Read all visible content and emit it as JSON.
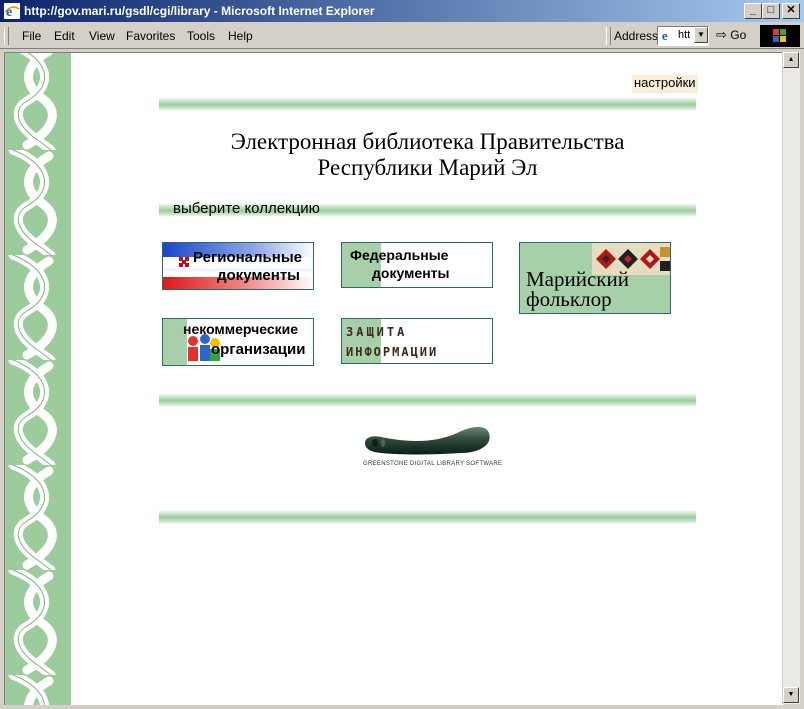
{
  "window": {
    "title": "http://gov.mari.ru/gsdl/cgi/library - Microsoft Internet Explorer",
    "minimize": "_",
    "maximize": "□",
    "close": "✕"
  },
  "menu": {
    "file": "File",
    "edit": "Edit",
    "view": "View",
    "favorites": "Favorites",
    "tools": "Tools",
    "help": "Help"
  },
  "address": {
    "label": "Address",
    "value": "htt",
    "go": "Go"
  },
  "page": {
    "preferences": "настройки",
    "heading_line1": "Электронная библиотека Правительства",
    "heading_line2": "Республики Марий Эл",
    "choose_collection": "выберите коллекцию",
    "collections": [
      {
        "line1": "Региональные",
        "line2": "документы"
      },
      {
        "line1": "Федеральные",
        "line2": "документы"
      },
      {
        "line1": "Марийский",
        "line2": "фольклор"
      },
      {
        "line1": "некоммерческие",
        "line2": "организации"
      },
      {
        "line1": "ЗАЩИТА",
        "line2": "ИНФОРМАЦИИ"
      }
    ],
    "greenstone_label": "GREENSTONE DIGITAL LIBRARY SOFTWARE"
  },
  "colors": {
    "accent_green": "#9ccc9c",
    "titlebar": "#0a246a"
  }
}
